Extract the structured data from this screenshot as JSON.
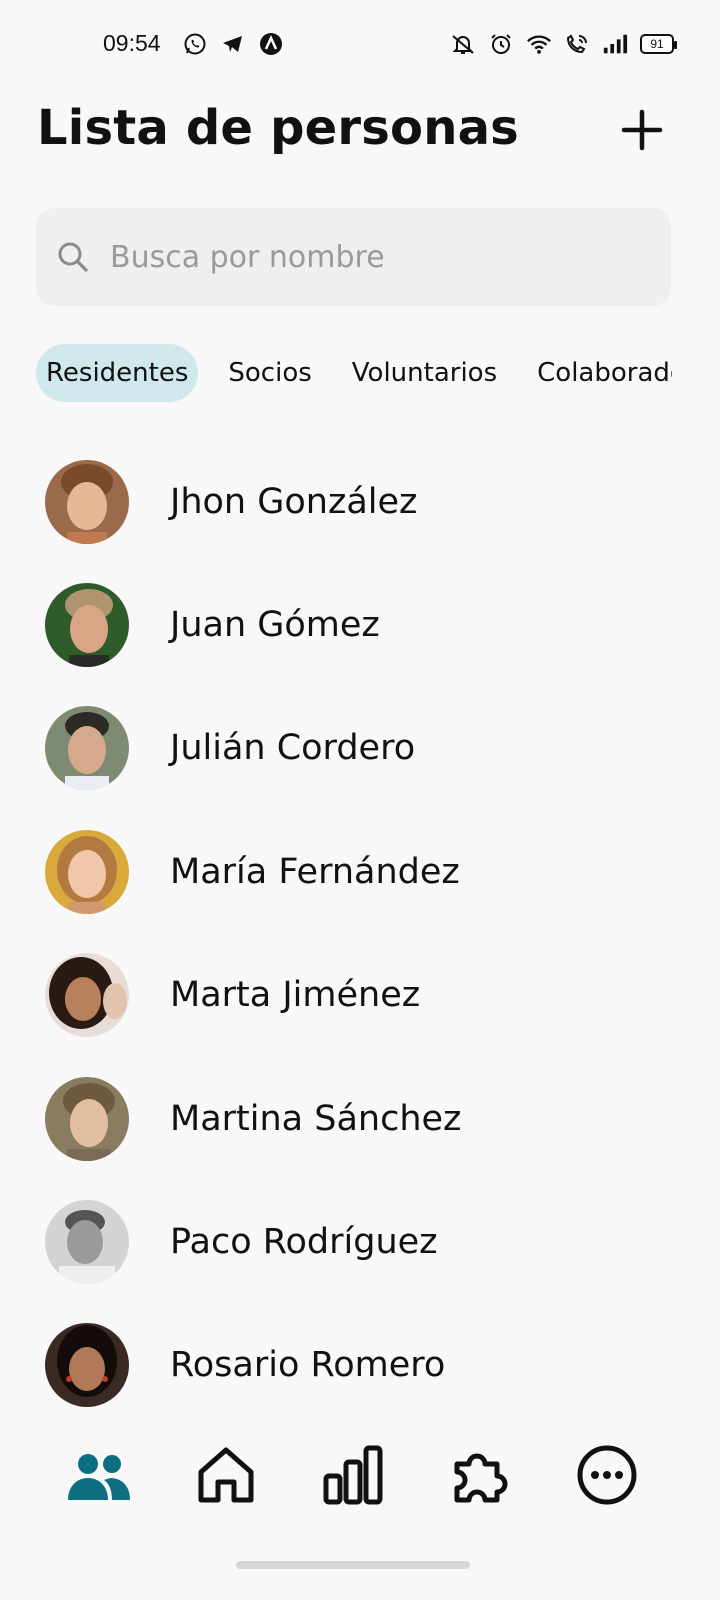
{
  "status_bar": {
    "time": "09:54",
    "battery": "91",
    "left_icons": [
      "whatsapp-icon",
      "telegram-icon",
      "app-a-icon"
    ],
    "right_icons": [
      "mute-icon",
      "alarm-icon",
      "wifi-icon",
      "wifi-call-icon",
      "signal-icon"
    ]
  },
  "header": {
    "title": "Lista de personas",
    "add_icon": "plus-icon"
  },
  "search": {
    "placeholder": "Busca por nombre",
    "value": ""
  },
  "tabs": [
    {
      "label": "Residentes",
      "active": true
    },
    {
      "label": "Socios",
      "active": false
    },
    {
      "label": "Voluntarios",
      "active": false
    },
    {
      "label": "Colaboradores",
      "active": false
    }
  ],
  "people": [
    {
      "name": "Jhon González"
    },
    {
      "name": "Juan Gómez"
    },
    {
      "name": "Julián Cordero"
    },
    {
      "name": "María Fernández"
    },
    {
      "name": "Marta Jiménez"
    },
    {
      "name": "Martina Sánchez"
    },
    {
      "name": "Paco Rodríguez"
    },
    {
      "name": "Rosario Romero"
    }
  ],
  "bottom_nav": [
    {
      "icon": "people-icon",
      "active": true
    },
    {
      "icon": "home-icon",
      "active": false
    },
    {
      "icon": "bar-chart-icon",
      "active": false
    },
    {
      "icon": "puzzle-icon",
      "active": false
    },
    {
      "icon": "more-icon",
      "active": false
    }
  ],
  "colors": {
    "accent": "#0f6f82",
    "tab_active_bg": "#cfe8ec",
    "background": "#f8f8f8",
    "search_bg": "#efefef"
  }
}
